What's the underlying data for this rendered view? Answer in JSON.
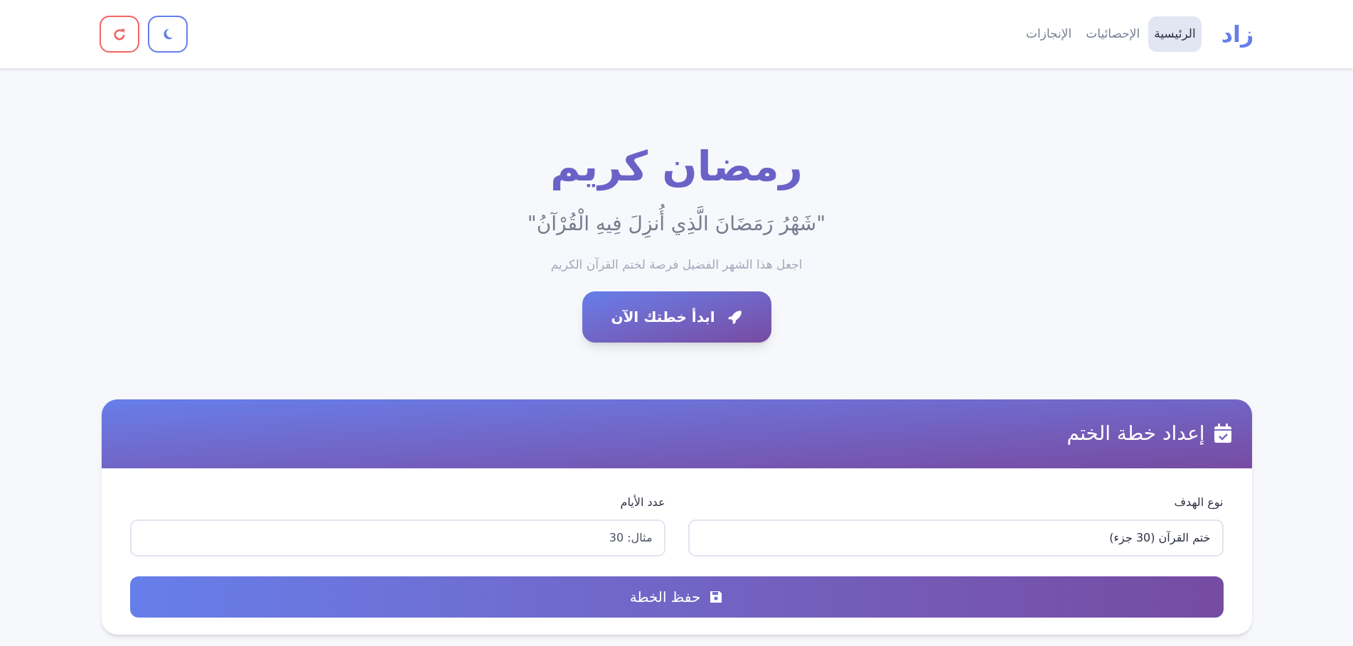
{
  "header": {
    "logo": "زاد",
    "nav": [
      {
        "label": "الرئيسية",
        "selected": true
      },
      {
        "label": "الإحصائيات",
        "selected": false
      },
      {
        "label": "الإنجازات",
        "selected": false
      }
    ]
  },
  "hero": {
    "title": "رمضان كريم",
    "verse": "\"شَهْرُ رَمَضَانَ الَّذِي أُنزِلَ فِيهِ الْقُرْآنُ\"",
    "subtitle": "اجعل هذا الشهر الفضيل فرصة لختم القرآن الكريم",
    "button": "ابدأ خطتك الآن"
  },
  "plan_card": {
    "title": "إعداد خطة الختم",
    "fields": [
      {
        "kind": "select",
        "label": "نوع الهدف",
        "value": "ختم القرآن (30 جزء)"
      },
      {
        "kind": "input",
        "label": "عدد الأيام",
        "placeholder": "مثال: 30"
      }
    ],
    "save_button": "حفظ الخطة"
  }
}
